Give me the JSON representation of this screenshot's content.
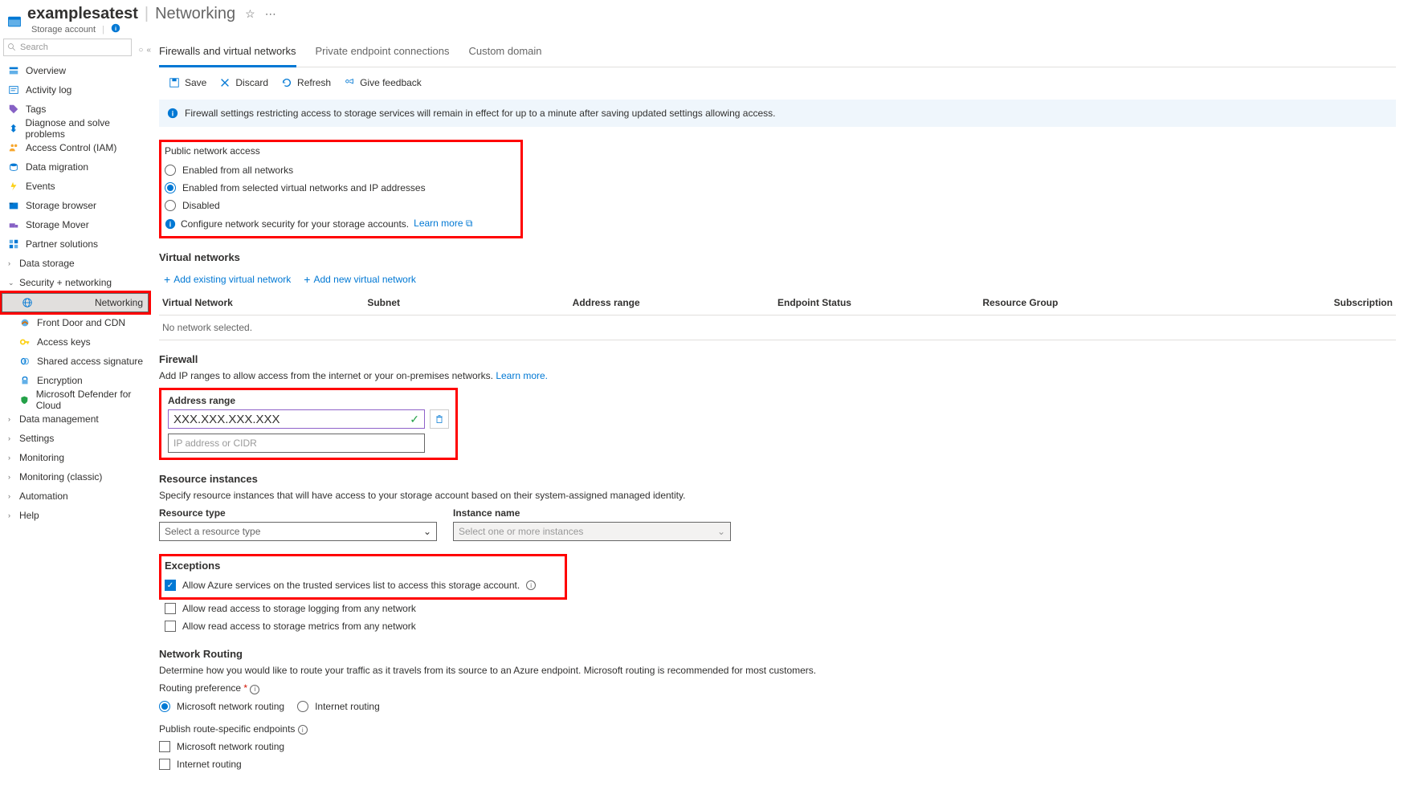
{
  "header": {
    "title": "examplesatest",
    "subtitle": "Networking",
    "type": "Storage account"
  },
  "search": {
    "placeholder": "Search"
  },
  "sidebar": {
    "overview": "Overview",
    "activity": "Activity log",
    "tags": "Tags",
    "diagnose": "Diagnose and solve problems",
    "iam": "Access Control (IAM)",
    "datamigration": "Data migration",
    "events": "Events",
    "storagebrowser": "Storage browser",
    "storagemover": "Storage Mover",
    "partner": "Partner solutions",
    "datastorage": "Data storage",
    "security": "Security + networking",
    "networking": "Networking",
    "frontdoor": "Front Door and CDN",
    "accesskeys": "Access keys",
    "sas": "Shared access signature",
    "encryption": "Encryption",
    "defender": "Microsoft Defender for Cloud",
    "datamgmt": "Data management",
    "settings": "Settings",
    "monitoring": "Monitoring",
    "monclassic": "Monitoring (classic)",
    "automation": "Automation",
    "help": "Help"
  },
  "tabs": {
    "t1": "Firewalls and virtual networks",
    "t2": "Private endpoint connections",
    "t3": "Custom domain"
  },
  "toolbar": {
    "save": "Save",
    "discard": "Discard",
    "refresh": "Refresh",
    "feedback": "Give feedback"
  },
  "banner": "Firewall settings restricting access to storage services will remain in effect for up to a minute after saving updated settings allowing access.",
  "pna": {
    "label": "Public network access",
    "opt1": "Enabled from all networks",
    "opt2": "Enabled from selected virtual networks and IP addresses",
    "opt3": "Disabled",
    "hint": "Configure network security for your storage accounts.",
    "learn": "Learn more"
  },
  "vnet": {
    "heading": "Virtual networks",
    "addExisting": "Add existing virtual network",
    "addNew": "Add new virtual network",
    "cols": {
      "c1": "Virtual Network",
      "c2": "Subnet",
      "c3": "Address range",
      "c4": "Endpoint Status",
      "c5": "Resource Group",
      "c6": "Subscription"
    },
    "empty": "No network selected."
  },
  "firewall": {
    "heading": "Firewall",
    "desc": "Add IP ranges to allow access from the internet or your on-premises networks.",
    "learn": "Learn more.",
    "col": "Address range",
    "value": "XXX.XXX.XXX.XXX",
    "placeholder": "IP address or CIDR"
  },
  "res": {
    "heading": "Resource instances",
    "desc": "Specify resource instances that will have access to your storage account based on their system-assigned managed identity.",
    "c1": "Resource type",
    "c2": "Instance name",
    "ph1": "Select a resource type",
    "ph2": "Select one or more instances"
  },
  "exc": {
    "heading": "Exceptions",
    "e1": "Allow Azure services on the trusted services list to access this storage account.",
    "e2": "Allow read access to storage logging from any network",
    "e3": "Allow read access to storage metrics from any network"
  },
  "routing": {
    "heading": "Network Routing",
    "desc": "Determine how you would like to route your traffic as it travels from its source to an Azure endpoint. Microsoft routing is recommended for most customers.",
    "pref": "Routing preference",
    "r1": "Microsoft network routing",
    "r2": "Internet routing",
    "pub": "Publish route-specific endpoints",
    "p1": "Microsoft network routing",
    "p2": "Internet routing"
  }
}
